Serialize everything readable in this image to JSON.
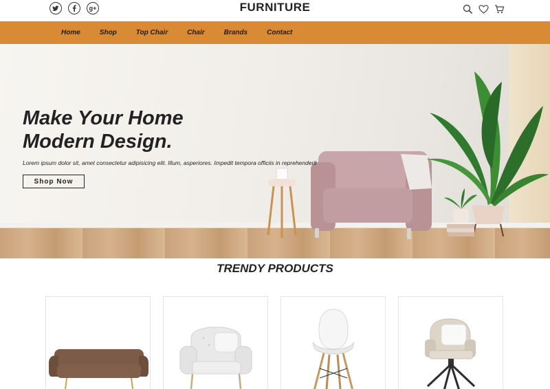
{
  "header": {
    "brand": "FURNITURE",
    "social": [
      {
        "icon": "twitter-icon",
        "glyph": "t"
      },
      {
        "icon": "facebook-icon",
        "glyph": "f"
      },
      {
        "icon": "google-plus-icon",
        "glyph": "g+"
      }
    ],
    "actions": [
      "search-icon",
      "heart-icon",
      "cart-icon"
    ]
  },
  "nav": {
    "items": [
      "Home",
      "Shop",
      "Top Chair",
      "Chair",
      "Brands",
      "Contact"
    ],
    "background": "#d98a34"
  },
  "hero": {
    "title_line1": "Make Your Home",
    "title_line2": "Modern Design.",
    "description": "Lorem ipsum dolor sit, amet consectetur adipisicing elit. Illum, asperiores. Impedit tempora officiis in reprehenderit",
    "cta": "Shop Now"
  },
  "trendy": {
    "title": "TRENDY PRODUCTS",
    "products": [
      {
        "name": "sofa"
      },
      {
        "name": "armchair"
      },
      {
        "name": "chair"
      },
      {
        "name": "swivel-chair"
      }
    ]
  }
}
